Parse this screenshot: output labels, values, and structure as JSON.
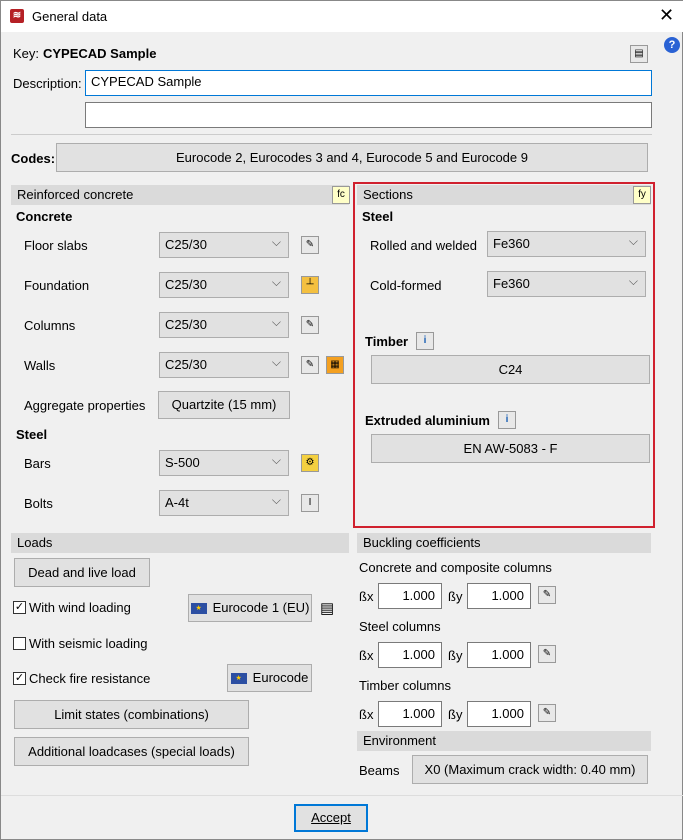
{
  "window": {
    "title": "General data",
    "close": "✕",
    "help": "?"
  },
  "key": {
    "label": "Key:",
    "value": "CYPECAD Sample"
  },
  "description": {
    "label": "Description:",
    "value": "CYPECAD Sample",
    "value2": ""
  },
  "codes": {
    "label": "Codes:",
    "value": "Eurocode 2, Eurocodes 3 and 4, Eurocode 5 and Eurocode 9"
  },
  "rc": {
    "title": "Reinforced concrete",
    "icon": "fc",
    "concrete": "Concrete",
    "rows": [
      {
        "label": "Floor slabs",
        "value": "C25/30"
      },
      {
        "label": "Foundation",
        "value": "C25/30"
      },
      {
        "label": "Columns",
        "value": "C25/30"
      },
      {
        "label": "Walls",
        "value": "C25/30"
      }
    ],
    "aggregate_label": "Aggregate properties",
    "aggregate_value": "Quartzite (15 mm)",
    "steel": "Steel",
    "steel_rows": [
      {
        "label": "Bars",
        "value": "S-500"
      },
      {
        "label": "Bolts",
        "value": "A-4t"
      }
    ]
  },
  "sections": {
    "title": "Sections",
    "icon": "fy",
    "steel": "Steel",
    "rolled_label": "Rolled and welded",
    "rolled_value": "Fe360",
    "cold_label": "Cold-formed",
    "cold_value": "Fe360",
    "timber_label": "Timber",
    "timber_value": "C24",
    "alu_label": "Extruded aluminium",
    "alu_value": "EN AW-5083 - F",
    "highlight": "#d0202e"
  },
  "loads": {
    "title": "Loads",
    "dead_live": "Dead and live load",
    "wind": {
      "label": "With wind loading",
      "checked": true,
      "button": "Eurocode 1 (EU)"
    },
    "seismic": {
      "label": "With seismic loading",
      "checked": false
    },
    "fire": {
      "label": "Check fire resistance",
      "checked": true,
      "button": "Eurocode"
    },
    "limit_states": "Limit states (combinations)",
    "additional": "Additional loadcases (special loads)"
  },
  "buckling": {
    "title": "Buckling coefficients",
    "bx": "ßx",
    "by": "ßy",
    "groups": [
      {
        "label": "Concrete and composite columns",
        "bx": "1.000",
        "by": "1.000"
      },
      {
        "label": "Steel columns",
        "bx": "1.000",
        "by": "1.000"
      },
      {
        "label": "Timber columns",
        "bx": "1.000",
        "by": "1.000"
      }
    ]
  },
  "environment": {
    "title": "Environment",
    "beams_label": "Beams",
    "beams_value": "X0 (Maximum crack width: 0.40 mm)"
  },
  "footer": {
    "accept": "Accept"
  }
}
